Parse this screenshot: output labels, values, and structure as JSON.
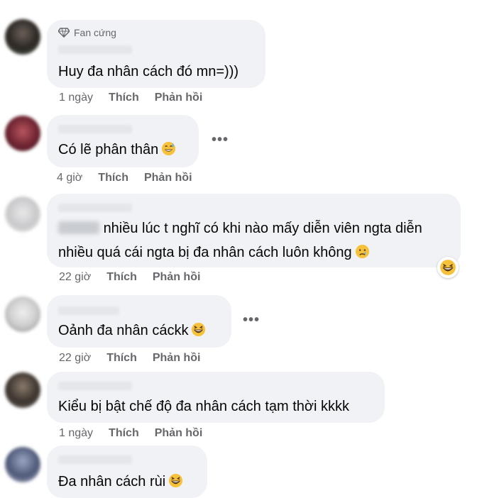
{
  "colors": {
    "bubble": "#f0f2f5",
    "meta": "#65676b",
    "text": "#050505"
  },
  "comments": [
    {
      "badge": "Fan cứng",
      "text": "Huy đa nhân cách đó mn=)))",
      "time": "1 ngày",
      "like": "Thích",
      "reply": "Phản hồi"
    },
    {
      "text": "Có lẽ phân thân",
      "emoji": "grinning-sweat-emoji",
      "time": "4 giờ",
      "like": "Thích",
      "reply": "Phản hồi"
    },
    {
      "text": "nhiều lúc t nghĩ có khi nào mấy diễn viên ngta diễn nhiều quá cái ngta bị đa nhân cách luôn không",
      "emoji": "sad-relieved-emoji",
      "time": "22 giờ",
      "like": "Thích",
      "reply": "Phản hồi",
      "reaction": "laughing-face-emoji"
    },
    {
      "text": "Oảnh đa nhân cáckk",
      "emoji": "laughing-emoji",
      "time": "22 giờ",
      "like": "Thích",
      "reply": "Phản hồi"
    },
    {
      "text": "Kiểu bị bật chế độ đa nhân cách tạm thời kkkk",
      "time": "1 ngày",
      "like": "Thích",
      "reply": "Phản hồi"
    },
    {
      "text": "Đa nhân cách rùi",
      "emoji": "laughing-emoji"
    }
  ]
}
